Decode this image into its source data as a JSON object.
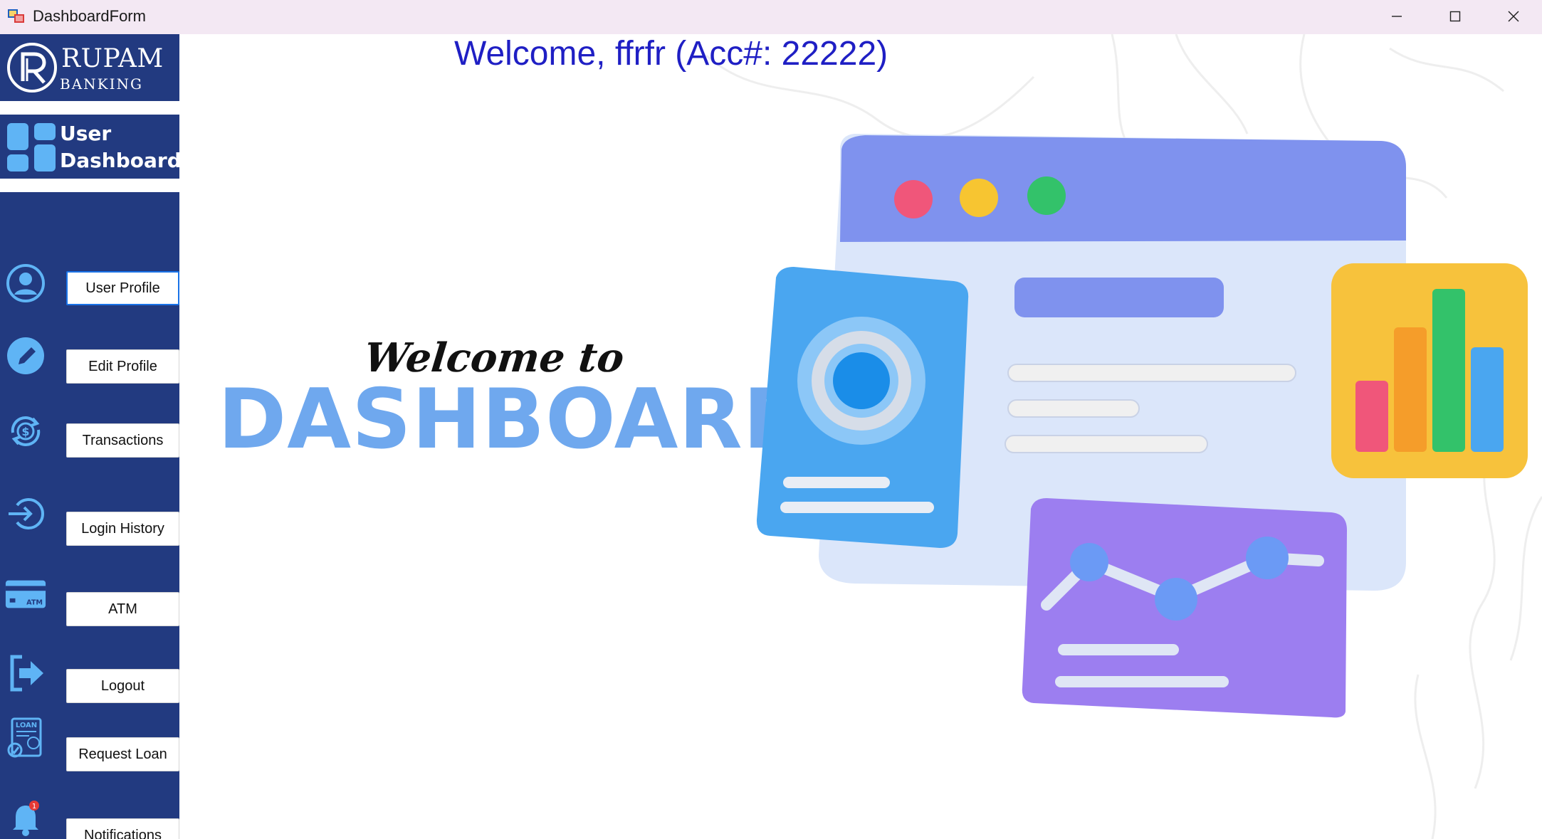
{
  "window": {
    "title": "DashboardForm"
  },
  "sidebar": {
    "logo_main": "RUPAM",
    "logo_sub": "BANKING",
    "panel_title": "User Dashboard",
    "items": [
      {
        "label": "User Profile",
        "icon": "user-circle-icon"
      },
      {
        "label": "Edit Profile",
        "icon": "pencil-icon"
      },
      {
        "label": "Transactions",
        "icon": "dollar-cycle-icon"
      },
      {
        "label": "Login History",
        "icon": "login-arrow-icon"
      },
      {
        "label": "ATM",
        "icon": "atm-card-icon"
      },
      {
        "label": "Logout",
        "icon": "logout-icon"
      },
      {
        "label": "Request Loan",
        "icon": "loan-document-icon"
      },
      {
        "label": "Notifications",
        "icon": "bell-icon"
      }
    ]
  },
  "main": {
    "welcome_text": "Welcome, ffrfr (Acc#: 22222)",
    "banner_script": "Welcome to",
    "banner_title": "DASHBOARD"
  },
  "colors": {
    "sidebar_bg": "#223a80",
    "welcome_text": "#1f1fc4",
    "banner_title": "#6fa8ee",
    "titlebar_bg": "#f3e8f3"
  }
}
